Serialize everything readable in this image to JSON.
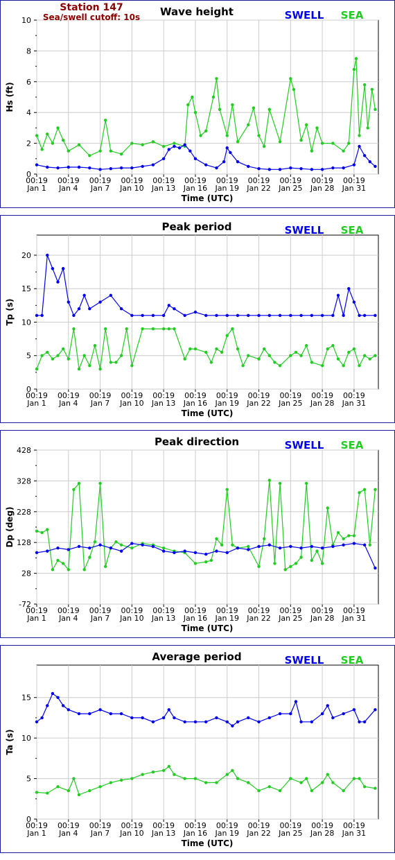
{
  "station": {
    "name": "Station 147",
    "cutoff": "Sea/swell cutoff: 10s"
  },
  "legend": {
    "swell_label": "SWELL",
    "sea_label": "SEA"
  },
  "colors": {
    "swell": "#0000ee",
    "sea": "#22cc22",
    "title_red": "#8b0000",
    "border": "#1a1a9c",
    "grid": "#cccccc"
  },
  "xaxis": {
    "label": "Time (UTC)",
    "tick_times": [
      "00:19",
      "00:19",
      "00:19",
      "00:19",
      "00:19",
      "00:19",
      "00:19",
      "00:19",
      "00:19",
      "00:19",
      "00:19"
    ],
    "tick_dates": [
      "Jan 1",
      "Jan 4",
      "Jan 7",
      "Jan 10",
      "Jan 13",
      "Jan 16",
      "Jan 19",
      "Jan 22",
      "Jan 25",
      "Jan 28",
      "Jan 31"
    ],
    "tick_days": [
      1,
      4,
      7,
      10,
      13,
      16,
      19,
      22,
      25,
      28,
      31
    ],
    "range": [
      1,
      33.3
    ]
  },
  "chart_data": [
    {
      "type": "line",
      "title": "Wave height",
      "ylabel": "Hs (ft)",
      "ylim": [
        0,
        10
      ],
      "yticks": [
        0,
        2,
        4,
        6,
        8,
        10
      ],
      "grid": true,
      "legend": "top-right",
      "series": [
        {
          "name": "SWELL",
          "x": [
            1,
            2,
            3,
            4,
            5,
            6,
            7,
            8,
            9,
            10,
            11,
            12,
            13,
            13.5,
            14,
            14.5,
            15,
            15.5,
            16,
            17,
            18,
            18.7,
            19,
            19.3,
            20,
            21,
            22,
            23,
            24,
            25,
            26,
            27,
            28,
            29,
            30,
            31,
            31.5,
            32,
            32.5,
            33
          ],
          "y": [
            0.6,
            0.45,
            0.4,
            0.45,
            0.45,
            0.4,
            0.3,
            0.35,
            0.4,
            0.4,
            0.5,
            0.6,
            1.0,
            1.6,
            1.8,
            1.7,
            1.9,
            1.5,
            1.0,
            0.6,
            0.4,
            0.8,
            1.7,
            1.4,
            0.8,
            0.5,
            0.35,
            0.3,
            0.3,
            0.4,
            0.35,
            0.3,
            0.3,
            0.4,
            0.4,
            0.6,
            1.8,
            1.2,
            0.8,
            0.5
          ]
        },
        {
          "name": "SEA",
          "x": [
            1,
            1.5,
            2,
            2.5,
            3,
            3.5,
            4,
            5,
            6,
            7,
            7.5,
            8,
            9,
            10,
            11,
            12,
            13,
            14,
            15,
            15.3,
            15.7,
            16,
            16.5,
            17,
            17.7,
            18,
            18.3,
            19,
            19.5,
            20,
            21,
            21.5,
            22,
            22.5,
            23,
            24,
            25,
            25.3,
            26,
            26.5,
            27,
            27.5,
            28,
            29,
            30,
            30.5,
            31,
            31.2,
            31.5,
            32,
            32.3,
            32.7,
            33
          ],
          "y": [
            2.5,
            1.6,
            2.6,
            2.0,
            3.0,
            2.2,
            1.5,
            1.9,
            1.2,
            1.5,
            3.5,
            1.5,
            1.3,
            2.0,
            1.9,
            2.1,
            1.8,
            2.0,
            1.8,
            4.5,
            5.0,
            4.0,
            2.5,
            2.8,
            5.0,
            6.2,
            4.2,
            2.5,
            4.5,
            2.1,
            3.2,
            4.3,
            2.5,
            1.8,
            4.2,
            2.1,
            6.2,
            5.5,
            2.2,
            3.2,
            1.5,
            3.0,
            2.0,
            2.0,
            1.5,
            2.0,
            6.8,
            7.5,
            2.5,
            5.8,
            3.0,
            5.5,
            4.2
          ]
        }
      ]
    },
    {
      "type": "line",
      "title": "Peak period",
      "ylabel": "Tp (s)",
      "ylim": [
        0,
        23
      ],
      "yticks": [
        0,
        5,
        10,
        15,
        20
      ],
      "grid": true,
      "legend": "top-right",
      "series": [
        {
          "name": "SWELL",
          "x": [
            1,
            1.5,
            2,
            2.5,
            3,
            3.5,
            4,
            4.5,
            5,
            5.5,
            6,
            7,
            8,
            9,
            10,
            11,
            12,
            13,
            13.5,
            14,
            15,
            16,
            17,
            18,
            19,
            20,
            21,
            22,
            23,
            24,
            25,
            26,
            27,
            28,
            29,
            29.5,
            30,
            30.5,
            31,
            31.5,
            32,
            33
          ],
          "y": [
            11,
            11,
            20,
            18,
            16,
            18,
            13,
            11,
            12,
            14,
            12,
            13,
            14,
            12,
            11,
            11,
            11,
            11,
            12.5,
            12,
            11,
            11.5,
            11,
            11,
            11,
            11,
            11,
            11,
            11,
            11,
            11,
            11,
            11,
            11,
            11,
            14,
            11,
            15,
            13,
            11,
            11,
            11
          ]
        },
        {
          "name": "SEA",
          "x": [
            1,
            1.5,
            2,
            2.5,
            3,
            3.5,
            4,
            4.5,
            5,
            5.5,
            6,
            6.5,
            7,
            7.5,
            8,
            8.5,
            9,
            9.5,
            10,
            11,
            12,
            13,
            13.5,
            14,
            15,
            15.5,
            16,
            17,
            17.5,
            18,
            18.5,
            19,
            19.5,
            20,
            20.5,
            21,
            22,
            22.5,
            23,
            23.5,
            24,
            25,
            25.5,
            26,
            26.5,
            27,
            28,
            28.5,
            29,
            29.5,
            30,
            30.5,
            31,
            31.5,
            32,
            32.5,
            33
          ],
          "y": [
            3,
            5,
            5.5,
            4.5,
            5,
            6,
            4.5,
            9,
            3,
            5,
            3.5,
            6.5,
            3,
            9,
            4,
            4,
            5,
            9,
            3.5,
            9,
            9,
            9,
            9,
            9,
            4.5,
            6,
            6,
            5.5,
            4,
            6,
            5.5,
            8,
            9,
            6,
            3.5,
            5,
            4.5,
            6,
            5,
            4,
            3.5,
            5,
            5.5,
            5,
            6.5,
            4,
            3.5,
            6,
            6.5,
            4.5,
            3.5,
            5.5,
            6,
            3.5,
            5,
            4.5,
            5
          ]
        }
      ]
    },
    {
      "type": "line",
      "title": "Peak direction",
      "ylabel": "Dp (deg)",
      "ylim": [
        -72,
        428
      ],
      "yticks": [
        -72,
        28,
        128,
        228,
        328,
        428
      ],
      "grid": true,
      "legend": "top-right",
      "series": [
        {
          "name": "SWELL",
          "x": [
            1,
            2,
            3,
            4,
            5,
            6,
            7,
            8,
            9,
            10,
            11,
            12,
            13,
            14,
            15,
            16,
            17,
            18,
            19,
            20,
            21,
            22,
            23,
            24,
            25,
            26,
            27,
            28,
            29,
            30,
            31,
            32,
            33
          ],
          "y": [
            95,
            100,
            110,
            105,
            115,
            110,
            120,
            110,
            100,
            125,
            120,
            115,
            100,
            95,
            100,
            95,
            90,
            100,
            95,
            110,
            105,
            115,
            120,
            110,
            115,
            110,
            115,
            110,
            115,
            120,
            125,
            120,
            45
          ]
        },
        {
          "name": "SEA",
          "x": [
            1,
            1.5,
            2,
            2.5,
            3,
            3.5,
            4,
            4.5,
            5,
            5.5,
            6,
            6.5,
            7,
            7.5,
            8,
            8.5,
            9,
            10,
            11,
            12,
            13,
            14,
            15,
            16,
            17,
            17.5,
            18,
            18.5,
            19,
            19.5,
            20,
            21,
            22,
            22.5,
            23,
            23.5,
            24,
            24.5,
            25,
            25.5,
            26,
            26.5,
            27,
            27.5,
            28,
            28.5,
            29,
            29.5,
            30,
            30.5,
            31,
            31.5,
            32,
            32.5,
            33
          ],
          "y": [
            165,
            160,
            170,
            40,
            70,
            60,
            40,
            300,
            320,
            40,
            80,
            130,
            320,
            50,
            110,
            130,
            120,
            110,
            125,
            120,
            110,
            100,
            95,
            60,
            65,
            70,
            140,
            120,
            300,
            120,
            110,
            115,
            50,
            140,
            330,
            60,
            320,
            40,
            50,
            60,
            80,
            320,
            70,
            100,
            60,
            240,
            120,
            160,
            140,
            150,
            150,
            290,
            300,
            120,
            300
          ]
        }
      ]
    },
    {
      "type": "line",
      "title": "Average period",
      "ylabel": "Ta (s)",
      "ylim": [
        0,
        19
      ],
      "yticks": [
        0,
        5,
        10,
        15
      ],
      "grid": true,
      "legend": "top-right",
      "series": [
        {
          "name": "SWELL",
          "x": [
            1,
            1.5,
            2,
            2.5,
            3,
            3.5,
            4,
            5,
            6,
            7,
            8,
            9,
            10,
            11,
            12,
            13,
            13.5,
            14,
            15,
            16,
            17,
            18,
            19,
            19.5,
            20,
            21,
            22,
            23,
            24,
            25,
            25.5,
            26,
            27,
            28,
            28.5,
            29,
            30,
            31,
            31.5,
            32,
            33
          ],
          "y": [
            12,
            12.5,
            14,
            15.5,
            15,
            14,
            13.5,
            13,
            13,
            13.5,
            13,
            13,
            12.5,
            12.5,
            12,
            12.5,
            13.5,
            12.5,
            12,
            12,
            12,
            12.5,
            12,
            11.5,
            12,
            12.5,
            12,
            12.5,
            13,
            13,
            14.5,
            12,
            12,
            13,
            14,
            12.5,
            13,
            13.5,
            12,
            12,
            13.5
          ]
        },
        {
          "name": "SEA",
          "x": [
            1,
            2,
            3,
            4,
            4.5,
            5,
            6,
            7,
            8,
            9,
            10,
            11,
            12,
            13,
            13.5,
            14,
            15,
            16,
            17,
            18,
            19,
            19.5,
            20,
            21,
            22,
            23,
            24,
            25,
            26,
            26.5,
            27,
            28,
            28.5,
            29,
            30,
            31,
            31.5,
            32,
            33
          ],
          "y": [
            3.3,
            3.2,
            4.0,
            3.5,
            5.0,
            3.0,
            3.5,
            4.0,
            4.5,
            4.8,
            5.0,
            5.5,
            5.8,
            6.0,
            6.5,
            5.5,
            5.0,
            5.0,
            4.5,
            4.5,
            5.5,
            6.0,
            5.0,
            4.5,
            3.5,
            4.0,
            3.5,
            5.0,
            4.5,
            5.0,
            3.5,
            4.5,
            5.5,
            4.5,
            3.5,
            5.0,
            5.0,
            4.0,
            3.8
          ]
        }
      ]
    }
  ]
}
